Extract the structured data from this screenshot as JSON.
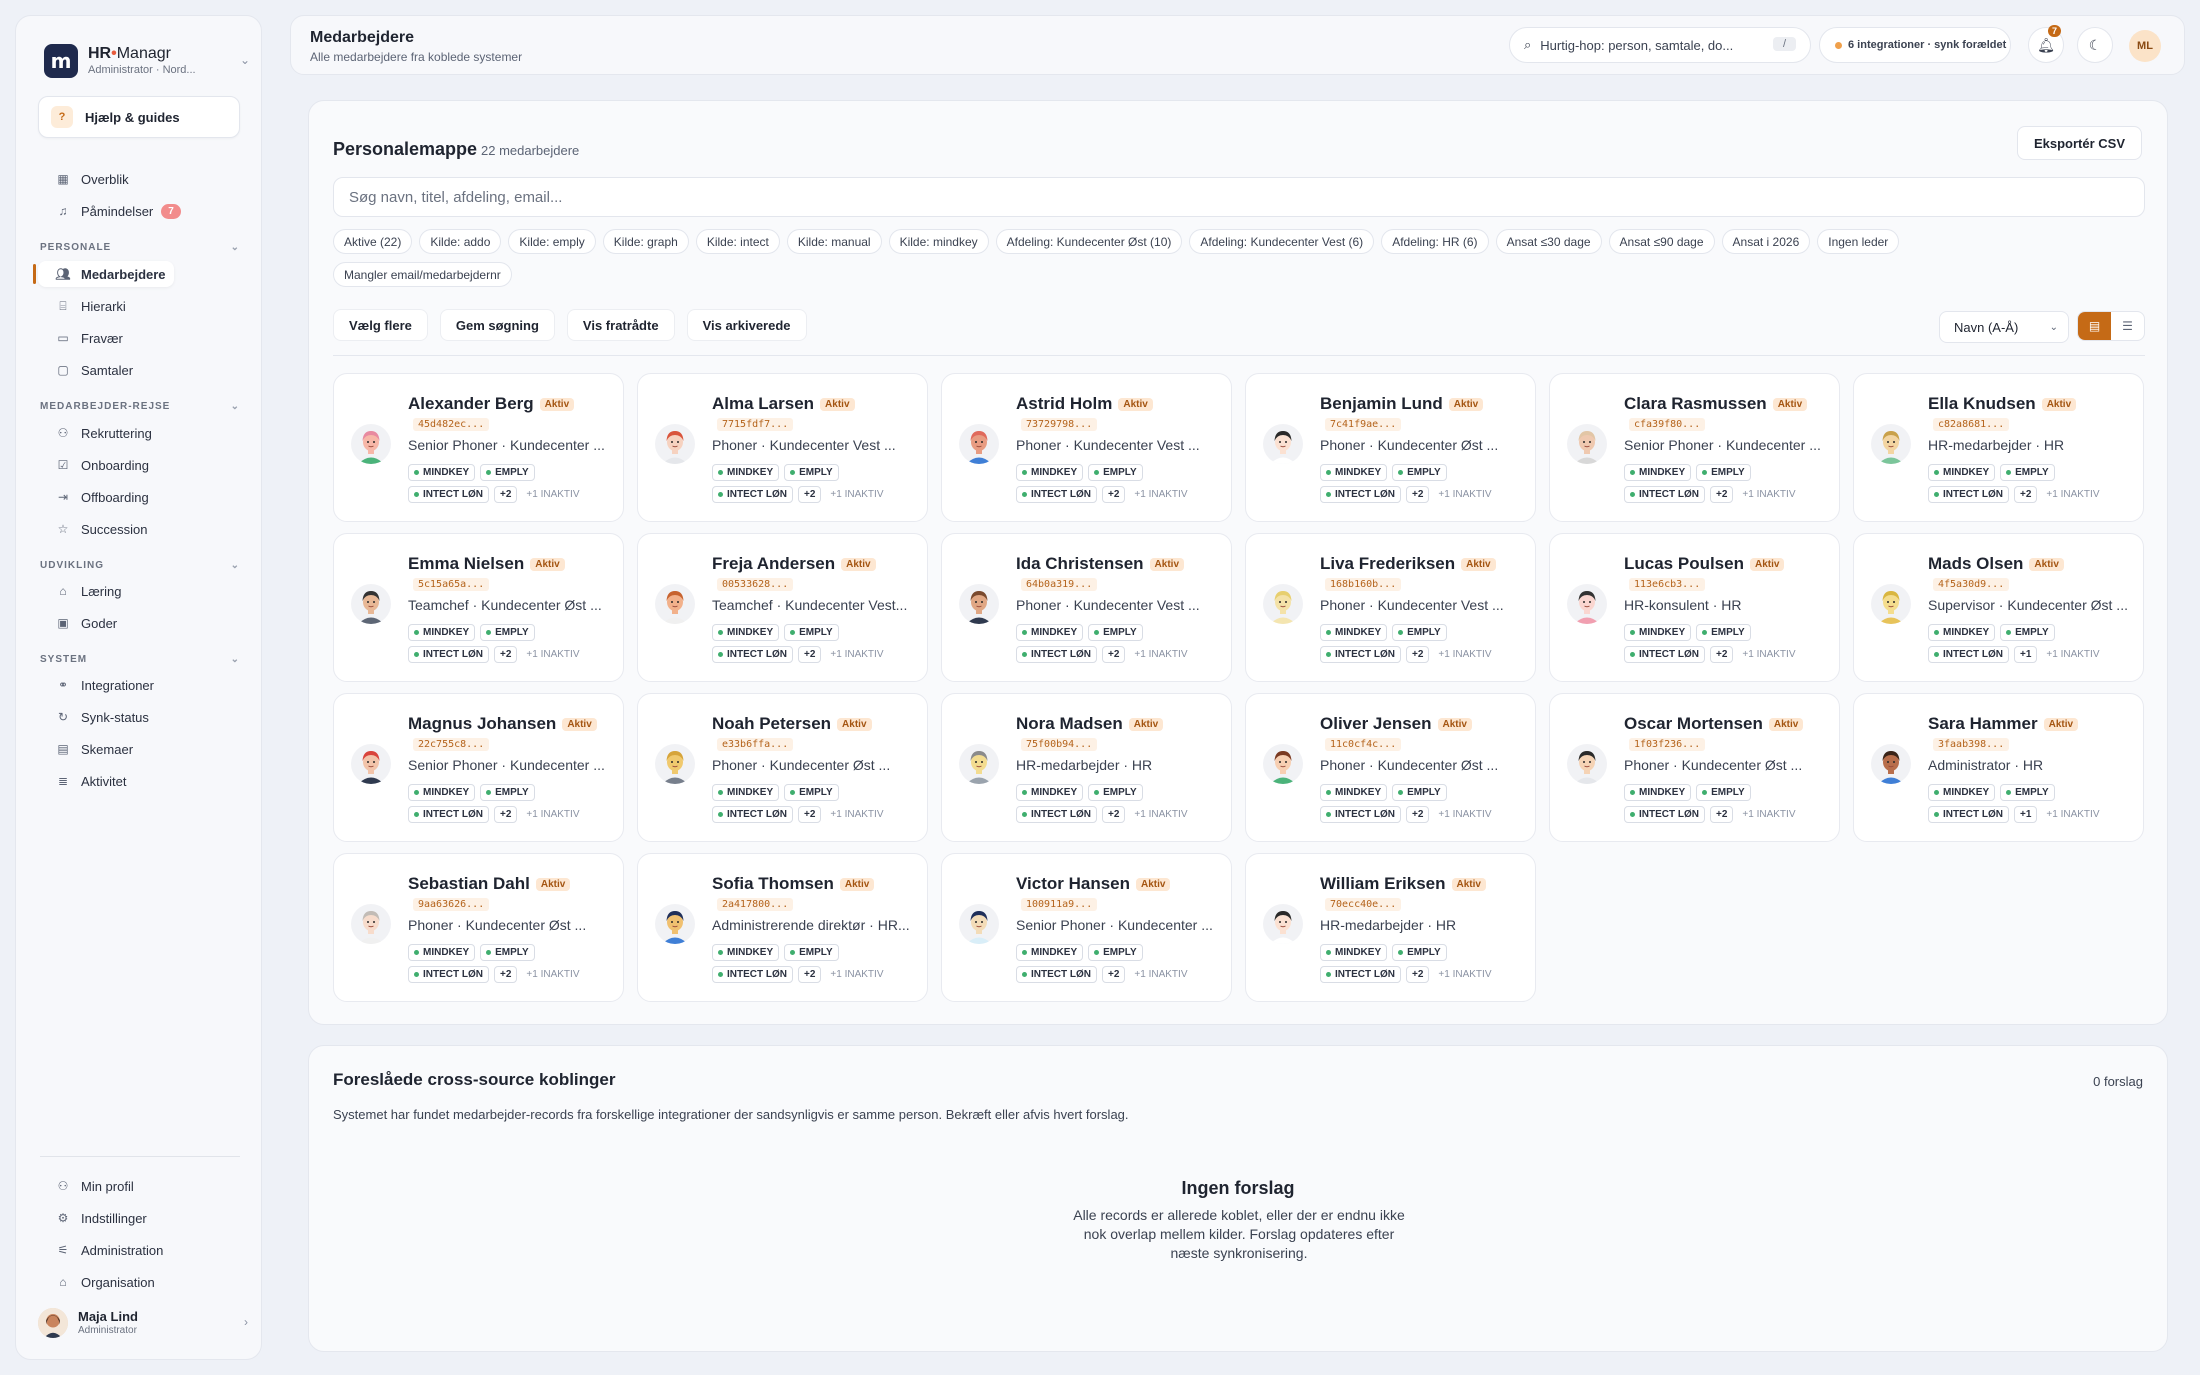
{
  "brand": {
    "name_bold": "HR",
    "name_light": "Managr",
    "subtitle": "Administrator · Nord...",
    "logo": "m"
  },
  "help": {
    "label": "Hjælp & guides",
    "icon": "?"
  },
  "nav": {
    "overview": "Overblik",
    "reminders": "Påmindelser",
    "reminders_count": "7",
    "section_personale": "PERSONALE",
    "employees": "Medarbejdere",
    "hierarchy": "Hierarki",
    "absence": "Fravær",
    "conversations": "Samtaler",
    "section_journey": "MEDARBEJDER-REJSE",
    "recruiting": "Rekruttering",
    "onboarding": "Onboarding",
    "offboarding": "Offboarding",
    "succession": "Succession",
    "section_dev": "UDVIKLING",
    "learning": "Læring",
    "benefits": "Goder",
    "section_system": "SYSTEM",
    "integrations": "Integrationer",
    "sync_status": "Synk-status",
    "schemas": "Skemaer",
    "activity": "Aktivitet",
    "profile": "Min profil",
    "settings": "Indstillinger",
    "administration": "Administration",
    "organisation": "Organisation"
  },
  "user": {
    "name": "Maja Lind",
    "role": "Administrator",
    "initials": "ML"
  },
  "header": {
    "title": "Medarbejdere",
    "subtitle": "Alle medarbejdere fra koblede systemer",
    "search_placeholder": "Hurtig-hop: person, samtale, do...",
    "search_kbd": "/",
    "sync_text": "6 integrationer · synk forældet",
    "notif_count": "7"
  },
  "main": {
    "title": "Personalemappe",
    "count": "22 medarbejdere",
    "export": "Eksportér CSV",
    "search_placeholder": "Søg navn, titel, afdeling, email...",
    "filters": [
      "Aktive (22)",
      "Kilde: addo",
      "Kilde: emply",
      "Kilde: graph",
      "Kilde: intect",
      "Kilde: manual",
      "Kilde: mindkey",
      "Afdeling: Kundecenter Øst (10)",
      "Afdeling: Kundecenter Vest (6)",
      "Afdeling: HR (6)",
      "Ansat ≤30 dage",
      "Ansat ≤90 dage",
      "Ansat i 2026",
      "Ingen leder",
      "Mangler email/medarbejdernr"
    ],
    "actions": [
      "Vælg flere",
      "Gem søgning",
      "Vis fratrådte",
      "Vis arkiverede"
    ],
    "sort": "Navn (A-Å)",
    "status_label": "Aktiv",
    "tag1": "MINDKEY",
    "tag2": "EMPLY",
    "tag3": "INTECT LØN",
    "inactive": "+1 INAKTIV"
  },
  "employees": [
    {
      "name": "Alexander Berg",
      "id": "45d482ec...",
      "role": "Senior Phoner · Kundecenter ...",
      "more": "+2",
      "skin": "#f7b7a8",
      "hair": "#e88aa0",
      "shirt": "#4bb37a"
    },
    {
      "name": "Alma Larsen",
      "id": "7715fdf7...",
      "role": "Phoner · Kundecenter Vest ...",
      "more": "+2",
      "skin": "#f6d2c0",
      "hair": "#d9543c",
      "shirt": "#e5e7eb"
    },
    {
      "name": "Astrid Holm",
      "id": "73729798...",
      "role": "Phoner · Kundecenter Vest ...",
      "more": "+2",
      "skin": "#e89c82",
      "hair": "#e06a5c",
      "shirt": "#3f7fd6"
    },
    {
      "name": "Benjamin Lund",
      "id": "7c41f9ae...",
      "role": "Phoner · Kundecenter Øst    ...",
      "more": "+2",
      "skin": "#fbe1d2",
      "hair": "#2a2a2a",
      "shirt": "#ffffff"
    },
    {
      "name": "Clara Rasmussen",
      "id": "cfa39f80...",
      "role": "Senior Phoner · Kundecenter ...",
      "more": "+2",
      "skin": "#efc9b0",
      "hair": "#e2c6a6",
      "shirt": "#d8d8d8"
    },
    {
      "name": "Ella Knudsen",
      "id": "c82a8681...",
      "role": "HR-medarbejder · HR",
      "more": "+2",
      "skin": "#f3d5a2",
      "hair": "#c9a14a",
      "shirt": "#7bc59a"
    },
    {
      "name": "Emma Nielsen",
      "id": "5c15a65a...",
      "role": "Teamchef · Kundecenter Øst ...",
      "more": "+2",
      "skin": "#e8b896",
      "hair": "#333333",
      "shirt": "#5d6675"
    },
    {
      "name": "Freja Andersen",
      "id": "00533628...",
      "role": "Teamchef · Kundecenter Vest...",
      "more": "+2",
      "skin": "#f2b18b",
      "hair": "#c7632f",
      "shirt": "#f0f0f0"
    },
    {
      "name": "Ida Christensen",
      "id": "64b0a319...",
      "role": "Phoner · Kundecenter Vest ...",
      "more": "+2",
      "skin": "#e0a784",
      "hair": "#7a4a2e",
      "shirt": "#2f3a4f"
    },
    {
      "name": "Liva Frederiksen",
      "id": "168b160b...",
      "role": "Phoner · Kundecenter Vest ...",
      "more": "+2",
      "skin": "#f4e2a8",
      "hair": "#e7cf6f",
      "shirt": "#f4e5b0"
    },
    {
      "name": "Lucas Poulsen",
      "id": "113e6cb3...",
      "role": "HR-konsulent · HR",
      "more": "+2",
      "skin": "#fad6d0",
      "hair": "#333333",
      "shirt": "#f19fb0"
    },
    {
      "name": "Mads Olsen",
      "id": "4f5a30d9...",
      "role": "Supervisor · Kundecenter Øst ...",
      "more": "+1",
      "skin": "#f4dd8e",
      "hair": "#d9b640",
      "shirt": "#e7c35a"
    },
    {
      "name": "Magnus Johansen",
      "id": "22c755c8...",
      "role": "Senior Phoner · Kundecenter ...",
      "more": "+2",
      "skin": "#f2c4aa",
      "hair": "#d9443c",
      "shirt": "#2f3a4f"
    },
    {
      "name": "Noah Petersen",
      "id": "e33b6ffa...",
      "role": "Phoner · Kundecenter Øst    ...",
      "more": "+2",
      "skin": "#f0c96e",
      "hair": "#d6a43a",
      "shirt": "#777f8c"
    },
    {
      "name": "Nora Madsen",
      "id": "75f00b94...",
      "role": "HR-medarbejder · HR",
      "more": "+2",
      "skin": "#f3dc90",
      "hair": "#8b8b8b",
      "shirt": "#9aa3ad"
    },
    {
      "name": "Oliver Jensen",
      "id": "11c0cf4c...",
      "role": "Phoner · Kundecenter Øst    ...",
      "more": "+2",
      "skin": "#f7cfb2",
      "hair": "#7a3a22",
      "shirt": "#4bb37a"
    },
    {
      "name": "Oscar Mortensen",
      "id": "1f03f236...",
      "role": "Phoner · Kundecenter Øst    ...",
      "more": "+2",
      "skin": "#f5d3b5",
      "hair": "#2a2a2a",
      "shirt": "#e5e7eb"
    },
    {
      "name": "Sara Hammer",
      "id": "3faab398...",
      "role": "Administrator · HR",
      "more": "+1",
      "skin": "#b86e4b",
      "hair": "#3a2418",
      "shirt": "#3f7fd6"
    },
    {
      "name": "Sebastian Dahl",
      "id": "9aa63626...",
      "role": "Phoner · Kundecenter Øst    ...",
      "more": "+2",
      "skin": "#f7dccc",
      "hair": "#c2bcb6",
      "shirt": "#f0f0f0"
    },
    {
      "name": "Sofia Thomsen",
      "id": "2a417800...",
      "role": "Administrerende direktør · HR...",
      "more": "+2",
      "skin": "#f0c070",
      "hair": "#1f2f5a",
      "shirt": "#3f7fd6"
    },
    {
      "name": "Victor Hansen",
      "id": "100911a9...",
      "role": "Senior Phoner · Kundecenter ...",
      "more": "+2",
      "skin": "#f3dcb8",
      "hair": "#1f2f5a",
      "shirt": "#d9eef8"
    },
    {
      "name": "William Eriksen",
      "id": "70ecc40e...",
      "role": "HR-medarbejder · HR",
      "more": "+2",
      "skin": "#fbe1d2",
      "hair": "#2a2a2a",
      "shirt": "#ffffff"
    }
  ],
  "suggestions": {
    "title": "Foreslåede cross-source koblinger",
    "count": "0 forslag",
    "description": "Systemet har fundet medarbejder-records fra forskellige integrationer der sandsynligvis er samme person. Bekræft eller afvis hvert forslag.",
    "empty_title": "Ingen forslag",
    "empty_text": "Alle records er allerede koblet, eller der er endnu ikke nok overlap mellem kilder. Forslag opdateres efter næste synkronisering."
  },
  "colors": {
    "accent": "#c56a16",
    "brand_dark": "#1f2a4d",
    "badge_red": "#f28c8c",
    "source_dot": "#3fae6e"
  }
}
